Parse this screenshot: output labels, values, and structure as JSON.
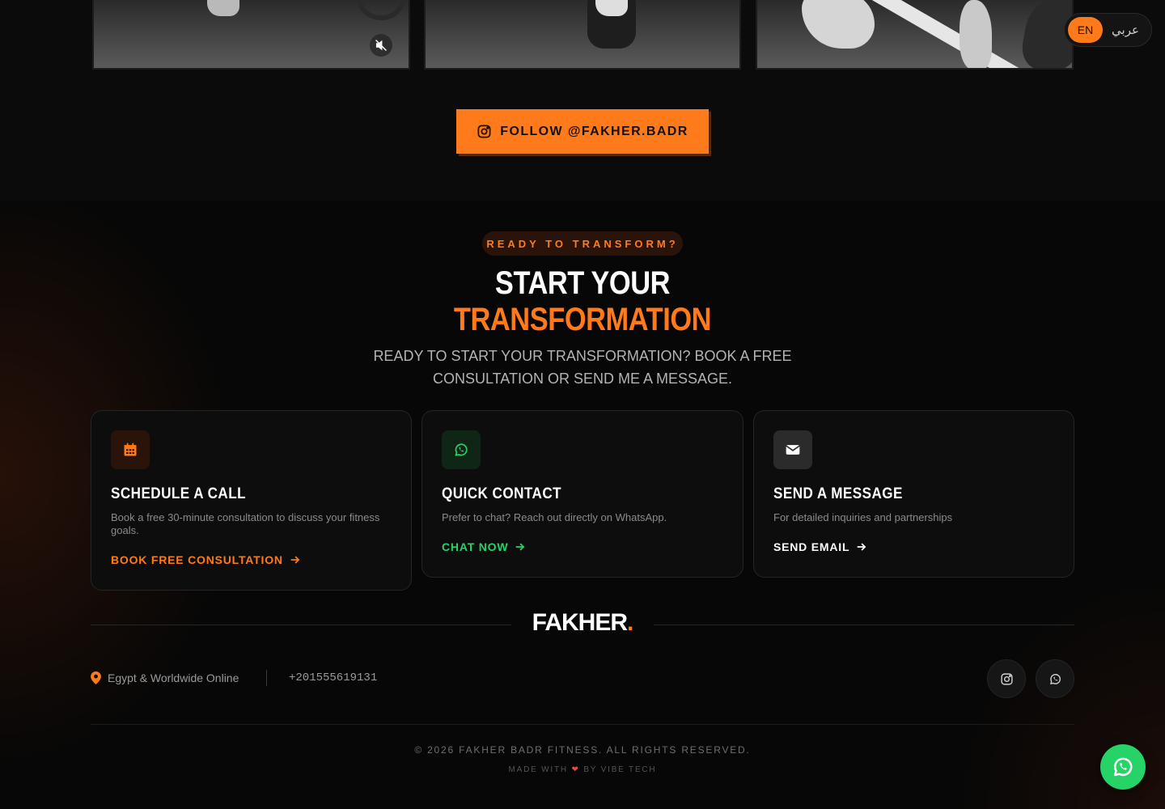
{
  "instagram": {
    "follow_label": "FOLLOW @FAKHER.BADR",
    "icons": [
      "instagram-icon",
      "mute-icon"
    ]
  },
  "language": {
    "en": "EN",
    "ar": "عربي",
    "active": "EN"
  },
  "contact": {
    "badge": "READY TO TRANSFORM?",
    "heading_line1": "START YOUR",
    "heading_line2": "TRANSFORMATION",
    "lead": "READY TO START YOUR TRANSFORMATION? BOOK A FREE CONSULTATION OR SEND ME A MESSAGE.",
    "cards": [
      {
        "icon": "calendar-icon",
        "title": "SCHEDULE A CALL",
        "desc": "Book a free 30-minute consultation to discuss your fitness goals.",
        "cta": "BOOK FREE CONSULTATION"
      },
      {
        "icon": "whatsapp-icon",
        "title": "QUICK CONTACT",
        "desc": "Prefer to chat? Reach out directly on WhatsApp.",
        "cta": "CHAT NOW"
      },
      {
        "icon": "envelope-icon",
        "title": "SEND A MESSAGE",
        "desc": "For detailed inquiries and partnerships",
        "cta": "SEND EMAIL"
      }
    ]
  },
  "footer": {
    "logo": "FAKHER",
    "logo_dot": ".",
    "location": "Egypt & Worldwide Online",
    "phone": "+201555619131",
    "copyright": "© 2026 FAKHER BADR FITNESS. ALL RIGHTS RESERVED.",
    "made_with_prefix": "MADE WITH",
    "made_with_suffix": "BY VIBE TECH"
  },
  "colors": {
    "accent": "#ff7a1a",
    "whatsapp": "#25d366",
    "background": "#0a0a0a"
  }
}
